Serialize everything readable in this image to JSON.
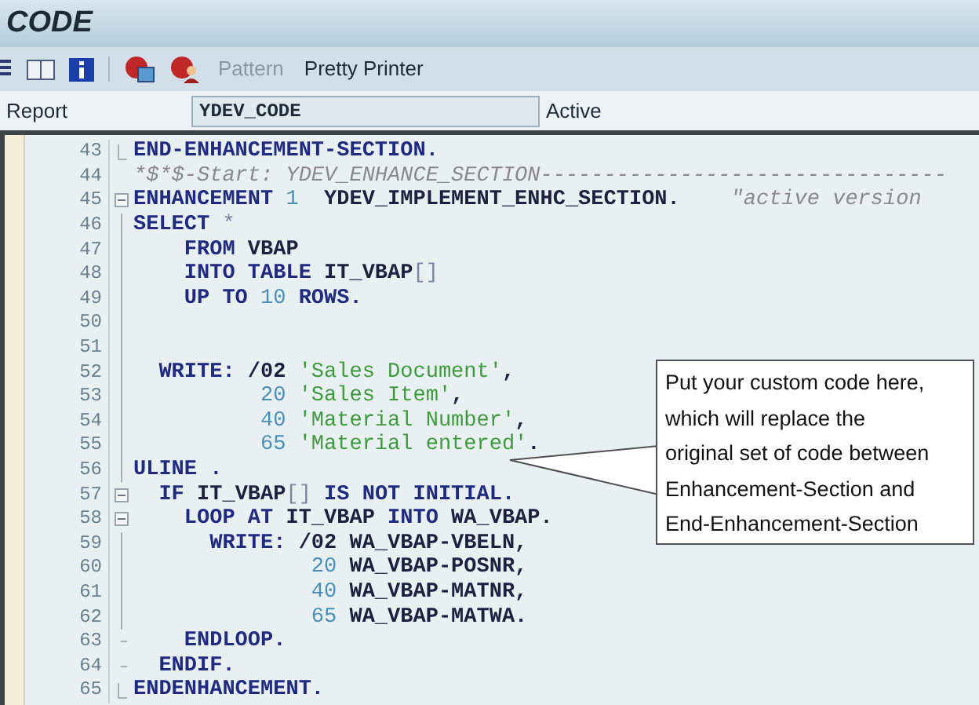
{
  "window": {
    "title": "CODE"
  },
  "toolbar": {
    "buttons": [
      {
        "label": "Pattern",
        "disabled": true
      },
      {
        "label": "Pretty Printer",
        "disabled": false
      }
    ]
  },
  "report": {
    "label": "Report",
    "value": "YDEV_CODE",
    "status": "Active"
  },
  "editor": {
    "lines": [
      {
        "number": "43",
        "kind": "end",
        "tokens": [
          {
            "kind": "kw",
            "text": "END-ENHANCEMENT-SECTION."
          }
        ]
      },
      {
        "number": "44",
        "kind": "none",
        "tokens": [
          {
            "kind": "comment",
            "text": "*$*$-Start: YDEV_ENHANCE_SECTION--------------------------------"
          }
        ]
      },
      {
        "number": "45",
        "kind": "open",
        "tokens": [
          {
            "kind": "kw",
            "text": "ENHANCEMENT "
          },
          {
            "kind": "num",
            "text": "1"
          },
          {
            "kind": "plain",
            "text": "  YDEV_IMPLEMENT_ENHC_SECTION.    "
          },
          {
            "kind": "comment",
            "text": "\"active version"
          }
        ]
      },
      {
        "number": "46",
        "kind": "line",
        "tokens": [
          {
            "kind": "kw",
            "text": "SELECT "
          },
          {
            "kind": "punct",
            "text": "*"
          }
        ]
      },
      {
        "number": "47",
        "kind": "line",
        "tokens": [
          {
            "kind": "kw",
            "text": "    FROM "
          },
          {
            "kind": "plain",
            "text": "VBAP"
          }
        ]
      },
      {
        "number": "48",
        "kind": "line",
        "tokens": [
          {
            "kind": "kw",
            "text": "    INTO TABLE "
          },
          {
            "kind": "plain",
            "text": "IT_VBAP"
          },
          {
            "kind": "punct",
            "text": "[]"
          }
        ]
      },
      {
        "number": "49",
        "kind": "line",
        "tokens": [
          {
            "kind": "kw",
            "text": "    UP TO "
          },
          {
            "kind": "num",
            "text": "10"
          },
          {
            "kind": "kw",
            "text": " ROWS."
          }
        ]
      },
      {
        "number": "50",
        "kind": "line"
      },
      {
        "number": "51",
        "kind": "line"
      },
      {
        "number": "52",
        "kind": "line",
        "tokens": [
          {
            "kind": "kw",
            "text": "  WRITE: "
          },
          {
            "kind": "plain",
            "text": "/02 "
          },
          {
            "kind": "str",
            "text": "'Sales Document'"
          },
          {
            "kind": "plain",
            "text": ","
          }
        ]
      },
      {
        "number": "53",
        "kind": "line",
        "tokens": [
          {
            "kind": "num",
            "text": "          20 "
          },
          {
            "kind": "str",
            "text": "'Sales Item'"
          },
          {
            "kind": "plain",
            "text": ","
          }
        ]
      },
      {
        "number": "54",
        "kind": "line",
        "tokens": [
          {
            "kind": "num",
            "text": "          40 "
          },
          {
            "kind": "str",
            "text": "'Material Number'"
          },
          {
            "kind": "plain",
            "text": ","
          }
        ]
      },
      {
        "number": "55",
        "kind": "line",
        "tokens": [
          {
            "kind": "num",
            "text": "          65 "
          },
          {
            "kind": "str",
            "text": "'Material entered'"
          },
          {
            "kind": "plain",
            "text": "."
          }
        ]
      },
      {
        "number": "56",
        "kind": "line",
        "tokens": [
          {
            "kind": "kw",
            "text": "ULINE ."
          }
        ]
      },
      {
        "number": "57",
        "kind": "open",
        "tokens": [
          {
            "kind": "kw",
            "text": "  IF "
          },
          {
            "kind": "plain",
            "text": "IT_VBAP"
          },
          {
            "kind": "punct",
            "text": "[]"
          },
          {
            "kind": "kw",
            "text": " IS NOT INITIAL."
          }
        ]
      },
      {
        "number": "58",
        "kind": "open",
        "tokens": [
          {
            "kind": "kw",
            "text": "    LOOP AT "
          },
          {
            "kind": "plain",
            "text": "IT_VBAP "
          },
          {
            "kind": "kw",
            "text": "INTO "
          },
          {
            "kind": "plain",
            "text": "WA_VBAP."
          }
        ]
      },
      {
        "number": "59",
        "kind": "line",
        "tokens": [
          {
            "kind": "kw",
            "text": "      WRITE: "
          },
          {
            "kind": "plain",
            "text": "/02 WA_VBAP-VBELN,"
          }
        ]
      },
      {
        "number": "60",
        "kind": "line",
        "tokens": [
          {
            "kind": "num",
            "text": "              20 "
          },
          {
            "kind": "plain",
            "text": "WA_VBAP-POSNR,"
          }
        ]
      },
      {
        "number": "61",
        "kind": "line",
        "tokens": [
          {
            "kind": "num",
            "text": "              40 "
          },
          {
            "kind": "plain",
            "text": "WA_VBAP-MATNR,"
          }
        ]
      },
      {
        "number": "62",
        "kind": "line",
        "tokens": [
          {
            "kind": "num",
            "text": "              65 "
          },
          {
            "kind": "plain",
            "text": "WA_VBAP-MATWA."
          }
        ]
      },
      {
        "number": "63",
        "kind": "tick",
        "tokens": [
          {
            "kind": "kw",
            "text": "    ENDLOOP."
          }
        ]
      },
      {
        "number": "64",
        "kind": "tick",
        "tokens": [
          {
            "kind": "kw",
            "text": "  ENDIF."
          }
        ]
      },
      {
        "number": "65",
        "kind": "end",
        "tokens": [
          {
            "kind": "kw",
            "text": "ENDENHANCEMENT."
          }
        ]
      }
    ]
  },
  "callout": {
    "text": "Put your custom code here,\nwhich will replace the\noriginal set of code between\nEnhancement-Section and\nEnd-Enhancement-Section"
  }
}
